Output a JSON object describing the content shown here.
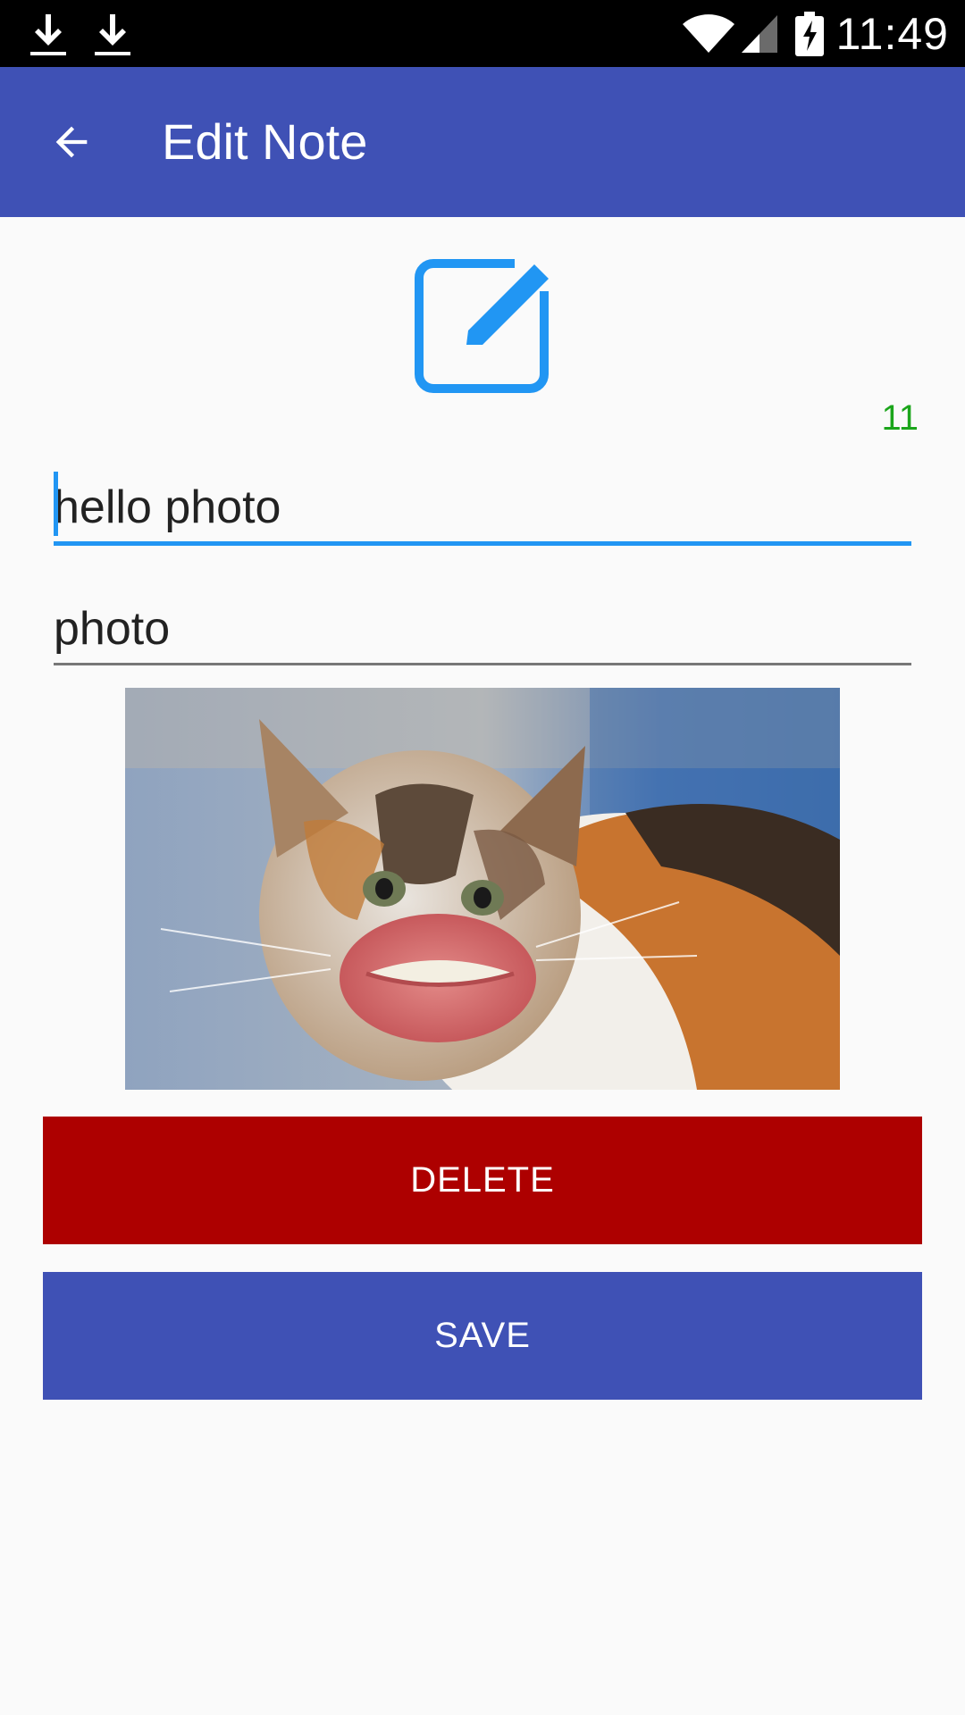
{
  "status_bar": {
    "time": "11:49",
    "icons": [
      "download-icon",
      "download-icon",
      "wifi-icon",
      "signal-icon",
      "battery-charging-icon"
    ]
  },
  "app_bar": {
    "title": "Edit Note",
    "back_icon": "arrow-back-icon"
  },
  "header_icon": "edit-note-icon",
  "char_count": "11",
  "form": {
    "title_value": "hello photo",
    "description_value": "photo"
  },
  "photo": {
    "subject": "cat-photo"
  },
  "buttons": {
    "delete_label": "DELETE",
    "save_label": "SAVE"
  },
  "colors": {
    "primary": "#3f51b5",
    "accent": "#2196f3",
    "delete": "#ad0000",
    "counter": "#1ba51b"
  }
}
